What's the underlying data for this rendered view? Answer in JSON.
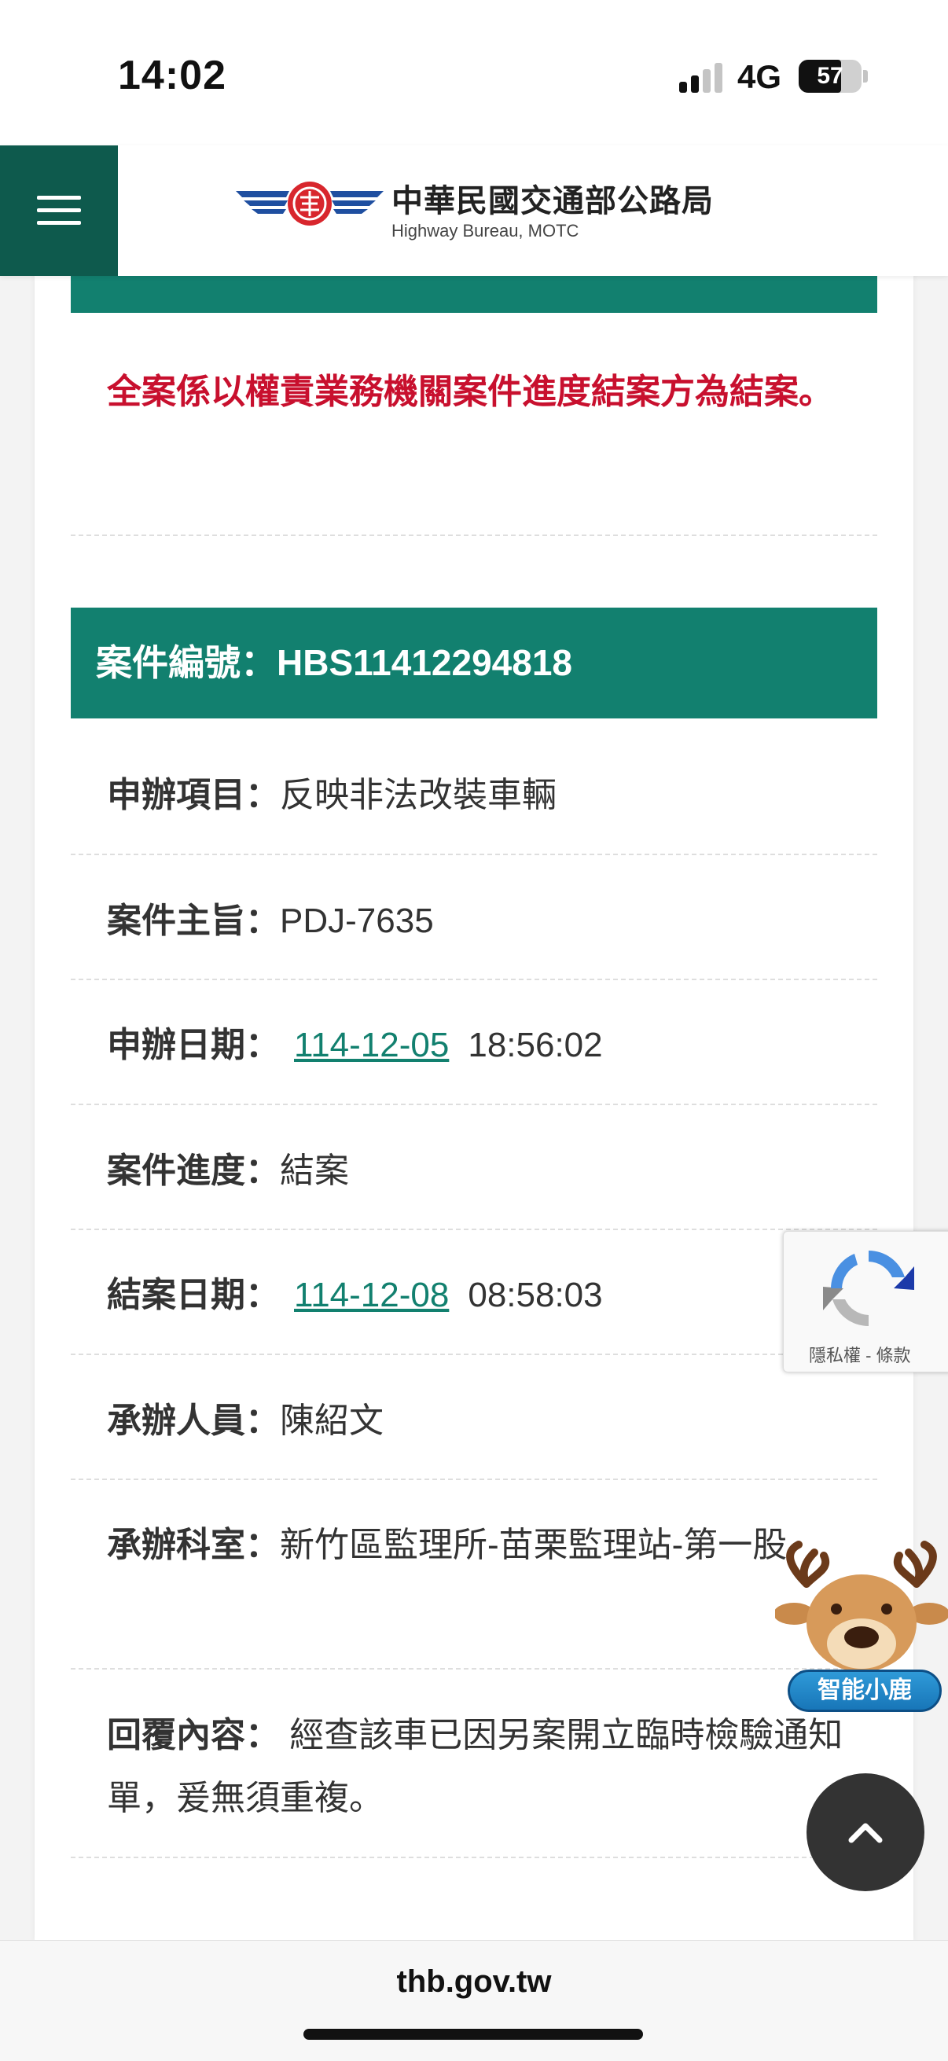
{
  "status_bar": {
    "time": "14:02",
    "network": "4G",
    "battery": "57"
  },
  "header": {
    "menu_icon": "hamburger-menu-icon",
    "logo_title": "中華民國交通部公路局",
    "logo_subtitle": "Highway Bureau, MOTC",
    "brand_color": "#0e5a4d"
  },
  "notice": {
    "text": "全案係以權責業務機關案件進度結案方為結案。",
    "color": "#c8102e"
  },
  "case": {
    "header": "案件編號：HBS11412294818",
    "accent_color": "#12806f",
    "fields": {
      "item": {
        "label": "申辦項目：",
        "value": "反映非法改裝車輛"
      },
      "subject": {
        "label": "案件主旨：",
        "value": "PDJ-7635"
      },
      "apply_date": {
        "label": "申辦日期：",
        "date": "114-12-05",
        "time": "18:56:02"
      },
      "progress": {
        "label": "案件進度：",
        "value": "結案"
      },
      "close_date": {
        "label": "結案日期：",
        "date": "114-12-08",
        "time": "08:58:03"
      },
      "handler": {
        "label": "承辦人員：",
        "value": "陳紹文"
      },
      "office": {
        "label": "承辦科室：",
        "value": "新竹區監理所-苗栗監理站-第一股"
      },
      "reply": {
        "label": "回覆內容：",
        "value": " 經查該車已因另案開立臨時檢驗通知單，爰無須重複。"
      }
    }
  },
  "recaptcha": {
    "icon": "recaptcha-icon",
    "text": "隱私權 - 條款"
  },
  "mascot": {
    "icon": "deer-mascot-icon",
    "label": "智能小鹿"
  },
  "back_to_top": {
    "icon": "chevron-up-icon"
  },
  "browser": {
    "url": "thb.gov.tw"
  }
}
